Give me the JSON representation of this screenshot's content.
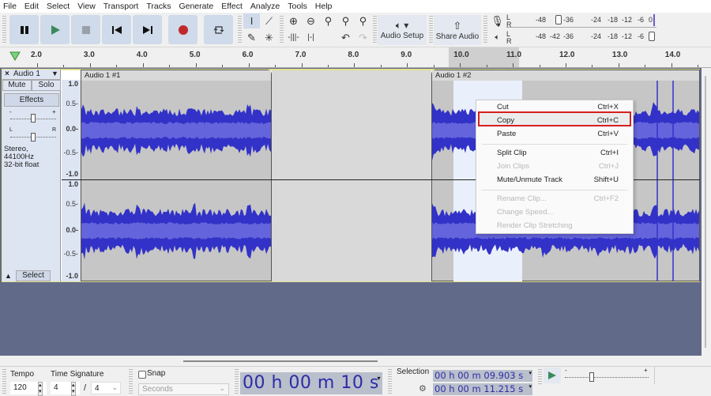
{
  "menubar": [
    "File",
    "Edit",
    "Select",
    "View",
    "Transport",
    "Tracks",
    "Generate",
    "Effect",
    "Analyze",
    "Tools",
    "Help"
  ],
  "transport": {
    "pause_icon": "pause-icon",
    "play_icon": "play-icon",
    "stop_icon": "stop-icon",
    "skip_start_icon": "skip-start-icon",
    "skip_end_icon": "skip-end-icon",
    "record_icon": "record-icon",
    "loop_icon": "loop-icon"
  },
  "tools": {
    "audio_setup_label": "Audio Setup",
    "share_audio_label": "Share Audio"
  },
  "meters": {
    "record_scale": [
      "-48",
      "-36",
      "-24",
      "-18",
      "-12",
      "-6",
      "0"
    ],
    "playback_scale": [
      "-48",
      "-42",
      "-36",
      "-24",
      "-18",
      "-12",
      "-6"
    ],
    "channels": [
      "L",
      "R"
    ]
  },
  "ruler": {
    "labels": [
      "2.0",
      "3.0",
      "4.0",
      "5.0",
      "6.0",
      "7.0",
      "8.0",
      "9.0",
      "10.0",
      "11.0",
      "12.0",
      "13.0",
      "14.0"
    ]
  },
  "track": {
    "name": "Audio 1",
    "mute_label": "Mute",
    "solo_label": "Solo",
    "effects_label": "Effects",
    "gain_minus": "-",
    "gain_plus": "+",
    "pan_left": "L",
    "pan_right": "R",
    "format_line1": "Stereo, 44100Hz",
    "format_line2": "32-bit float",
    "select_label": "Select",
    "scale": [
      "1.0",
      "0.5-",
      "0.0-",
      "-0.5-",
      "-1.0"
    ],
    "clips": [
      {
        "name": "Audio 1 #1"
      },
      {
        "name": "Audio 1 #2"
      }
    ]
  },
  "context_menu": {
    "items": [
      {
        "label": "Cut",
        "shortcut": "Ctrl+X",
        "enabled": true
      },
      {
        "label": "Copy",
        "shortcut": "Ctrl+C",
        "enabled": true,
        "highlighted": true
      },
      {
        "label": "Paste",
        "shortcut": "Ctrl+V",
        "enabled": true
      },
      {
        "label": "Split Clip",
        "shortcut": "Ctrl+I",
        "enabled": true
      },
      {
        "label": "Join Clips",
        "shortcut": "Ctrl+J",
        "enabled": false
      },
      {
        "label": "Mute/Unmute Track",
        "shortcut": "Shift+U",
        "enabled": true
      },
      {
        "label": "Rename Clip...",
        "shortcut": "Ctrl+F2",
        "enabled": false
      },
      {
        "label": "Change Speed...",
        "shortcut": "",
        "enabled": false
      },
      {
        "label": "Render Clip Stretching",
        "shortcut": "",
        "enabled": false
      }
    ]
  },
  "bottom": {
    "tempo_label": "Tempo",
    "tempo_value": "120",
    "time_signature_label": "Time Signature",
    "ts_numerator": "4",
    "ts_slash": "/",
    "ts_denominator": "4",
    "snap_label": "Snap",
    "snap_unit": "Seconds",
    "time_display": "00 h 00 m 10 s",
    "selection_label": "Selection",
    "selection_start": "00 h 00 m 09.903 s",
    "selection_end": "00 h 00 m 11.215 s",
    "play_speed_minus": "-",
    "play_speed_plus": "+"
  },
  "colors": {
    "waveform": "#3232c8",
    "waveform_rms": "#6464dc",
    "selection": "#eaf0fb",
    "record": "#c0292b",
    "play": "#3a8a5c",
    "highlight_border": "#d62020"
  }
}
